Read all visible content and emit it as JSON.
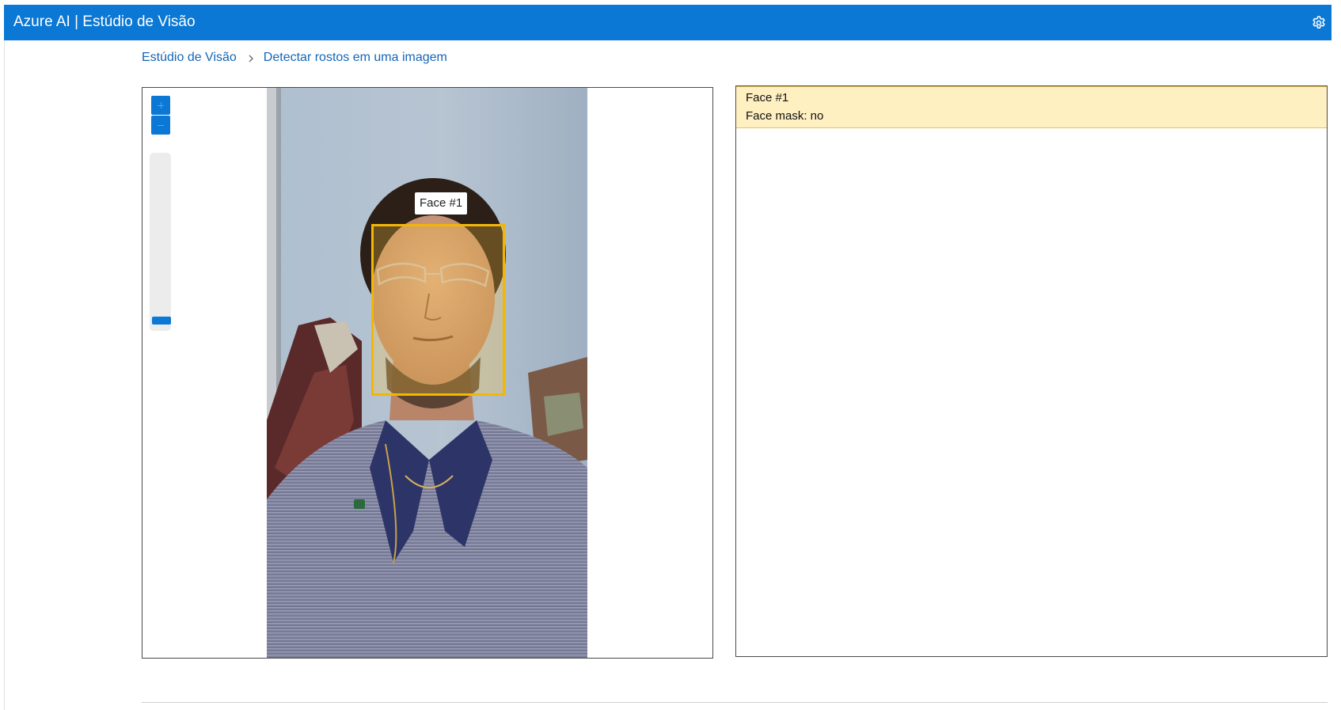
{
  "app": {
    "title": "Azure AI | Estúdio de Visão",
    "settings_icon": "gear-icon"
  },
  "breadcrumb": {
    "root": "Estúdio de Visão",
    "current": "Detectar rostos em uma imagem",
    "separator_icon": "chevron-right-icon"
  },
  "viewer": {
    "zoom_in_icon": "plus-icon",
    "zoom_out_icon": "minus-icon",
    "zoom_level": 0,
    "face_label": "Face #1"
  },
  "results": {
    "items": [
      {
        "title": "Face #1",
        "mask": "Face mask: no"
      }
    ]
  },
  "colors": {
    "accent": "#0a78d4",
    "face_box": "#f2b705",
    "result_highlight": "#fff0c2"
  }
}
